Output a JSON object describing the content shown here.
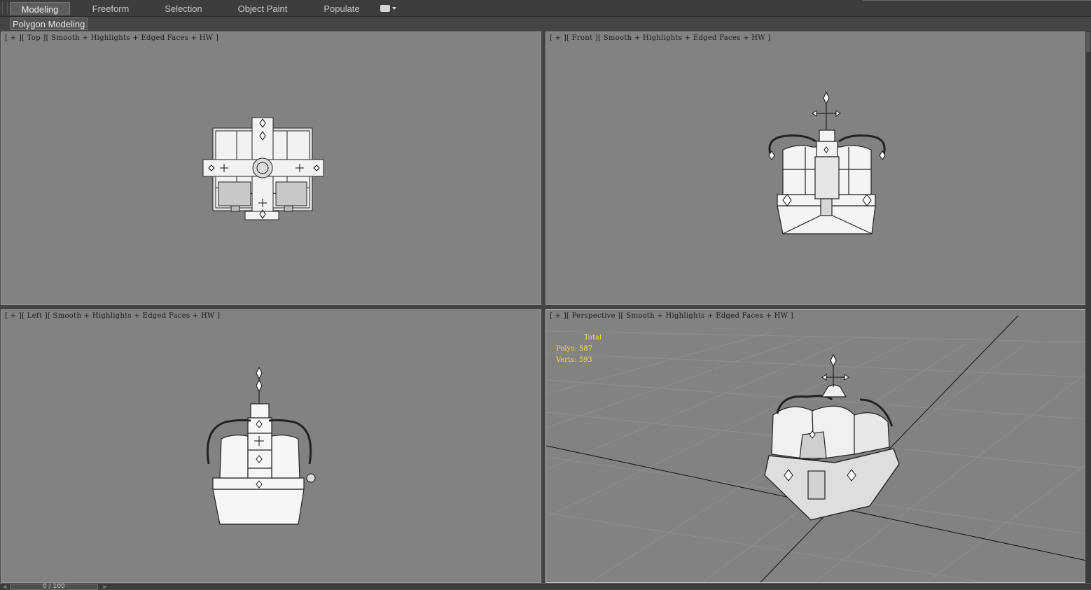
{
  "ribbon": {
    "tabs": [
      {
        "label": "Modeling",
        "active": true
      },
      {
        "label": "Freeform",
        "active": false
      },
      {
        "label": "Selection",
        "active": false
      },
      {
        "label": "Object Paint",
        "active": false
      },
      {
        "label": "Populate",
        "active": false
      }
    ],
    "panel_label": "Polygon Modeling"
  },
  "viewports": {
    "top": {
      "label": "[ + ][ Top ][ Smooth + Highlights + Edged Faces + HW ]"
    },
    "front": {
      "label": "[ + ][ Front ][ Smooth + Highlights + Edged Faces + HW ]"
    },
    "left": {
      "label": "[ + ][ Left ][ Smooth + Highlights + Edged Faces + HW ]"
    },
    "perspective": {
      "label": "[ + ][ Perspective ][ Smooth + Highlights + Edged Faces + HW ]",
      "stats": {
        "heading": "Total",
        "polys": "Polys: 587",
        "verts": "Verts: 593"
      }
    }
  },
  "timeline": {
    "frame": "0 / 100",
    "prev": "<",
    "next": ">"
  },
  "colors": {
    "viewport_bg": "#828282",
    "ui_bg": "#444444",
    "stats_text": "#f0e040"
  }
}
